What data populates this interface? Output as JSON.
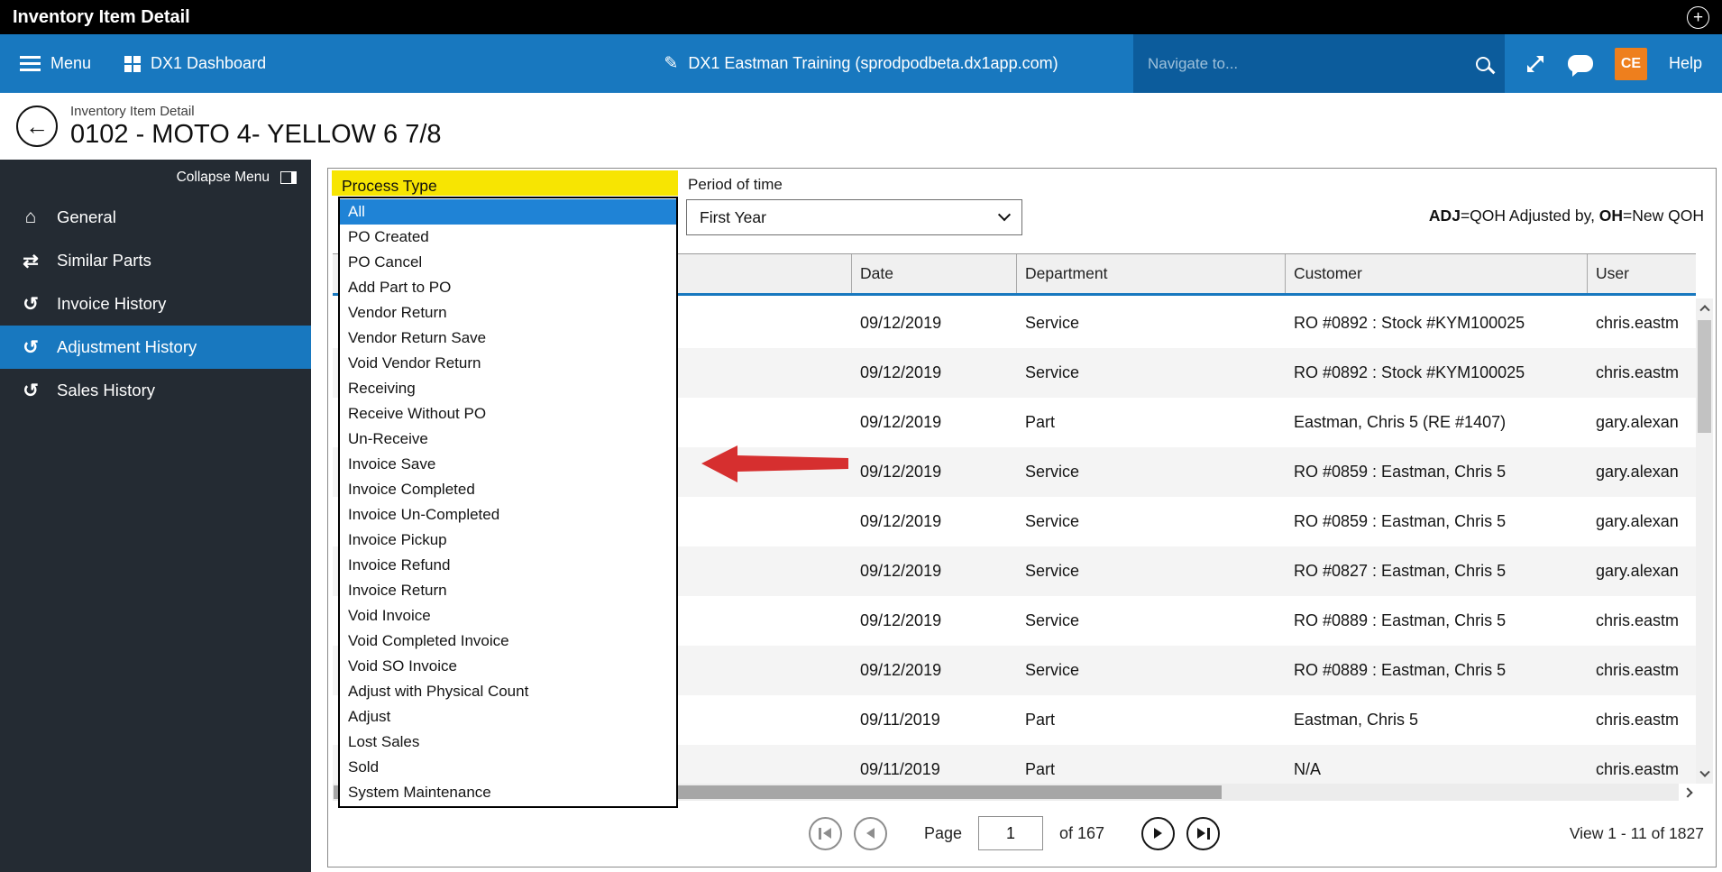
{
  "title_bar": {
    "title": "Inventory Item Detail"
  },
  "nav": {
    "menu_label": "Menu",
    "dashboard_label": "DX1 Dashboard",
    "site_label": "DX1 Eastman Training (sprodpodbeta.dx1app.com)",
    "navigate_placeholder": "Navigate to...",
    "avatar_initials": "CE",
    "help_label": "Help"
  },
  "page_header": {
    "breadcrumb": "Inventory Item Detail",
    "title": "0102 - MOTO 4- YELLOW 6 7/8"
  },
  "sidebar": {
    "collapse_label": "Collapse Menu",
    "items": [
      {
        "label": "General"
      },
      {
        "label": "Similar Parts"
      },
      {
        "label": "Invoice History"
      },
      {
        "label": "Adjustment History"
      },
      {
        "label": "Sales History"
      }
    ]
  },
  "filters": {
    "process_type_label": "Process Type",
    "process_type_selected": "All",
    "process_type_options": [
      "All",
      "PO Created",
      "PO Cancel",
      "Add Part to PO",
      "Vendor Return",
      "Vendor Return Save",
      "Void Vendor Return",
      "Receiving",
      "Receive Without PO",
      "Un-Receive",
      "Invoice Save",
      "Invoice Completed",
      "Invoice Un-Completed",
      "Invoice Pickup",
      "Invoice Refund",
      "Invoice Return",
      "Void Invoice",
      "Void Completed Invoice",
      "Void SO Invoice",
      "Adjust with Physical Count",
      "Adjust",
      "Lost Sales",
      "Sold",
      "System Maintenance"
    ],
    "period_label": "Period of time",
    "period_value": "First Year"
  },
  "legend": {
    "adj_key": "ADJ",
    "adj_text": "=QOH Adjusted by, ",
    "oh_key": "OH",
    "oh_text": "=New QOH"
  },
  "table": {
    "columns": {
      "date": "Date",
      "department": "Department",
      "customer": "Customer",
      "user": "User"
    },
    "rows": [
      {
        "date": "09/12/2019",
        "department": "Service",
        "customer": "RO #0892 : Stock #KYM100025",
        "user": "chris.eastm"
      },
      {
        "date": "09/12/2019",
        "department": "Service",
        "customer": "RO #0892 : Stock #KYM100025",
        "user": "chris.eastm"
      },
      {
        "date": "09/12/2019",
        "department": "Part",
        "customer": "Eastman, Chris 5 (RE #1407)",
        "user": "gary.alexan"
      },
      {
        "date": "09/12/2019",
        "department": "Service",
        "customer": "RO #0859 : Eastman, Chris 5",
        "user": "gary.alexan"
      },
      {
        "date": "09/12/2019",
        "department": "Service",
        "customer": "RO #0859 : Eastman, Chris 5",
        "user": "gary.alexan"
      },
      {
        "date": "09/12/2019",
        "department": "Service",
        "customer": "RO #0827 : Eastman, Chris 5",
        "user": "gary.alexan"
      },
      {
        "date": "09/12/2019",
        "department": "Service",
        "customer": "RO #0889 : Eastman, Chris 5",
        "user": "chris.eastm"
      },
      {
        "date": "09/12/2019",
        "department": "Service",
        "customer": "RO #0889 : Eastman, Chris 5",
        "user": "chris.eastm"
      },
      {
        "date": "09/11/2019",
        "department": "Part",
        "customer": "Eastman, Chris 5",
        "user": "chris.eastm"
      },
      {
        "date": "09/11/2019",
        "department": "Part",
        "customer": "N/A",
        "user": "chris.eastm"
      }
    ]
  },
  "pagination": {
    "page_label": "Page",
    "page_value": "1",
    "of_label": "of 167",
    "view_label": "View 1 - 11 of 1827"
  },
  "icons": {
    "add": "+",
    "back": "←",
    "edit": "✎",
    "home": "⌂",
    "similar": "⇄",
    "history": "↺"
  },
  "colors": {
    "nav_blue": "#1878bf",
    "selection_blue": "#1f83d6",
    "highlight_yellow": "#f7e502",
    "avatar_orange": "#ee7f1d",
    "arrow_red": "#d62f2f"
  }
}
